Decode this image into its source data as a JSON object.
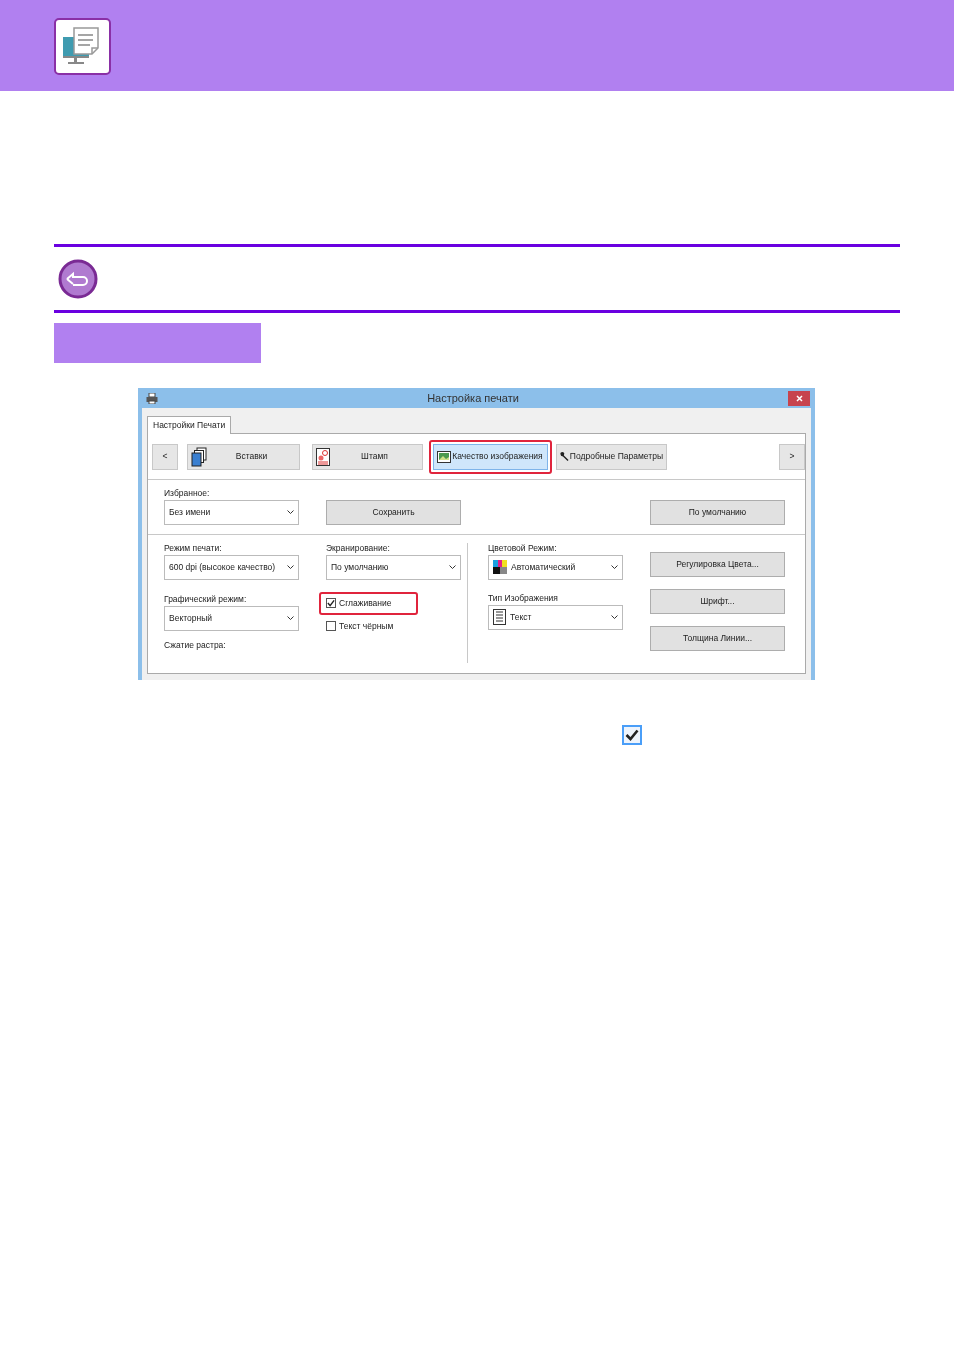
{
  "dialog": {
    "title": "Настройка печати",
    "tabs": [
      {
        "label": "Настройки Печати",
        "selected": true
      }
    ],
    "toolbar": {
      "prev": "<",
      "next": ">",
      "items": [
        {
          "label": "Вставки",
          "selected": false,
          "highlighted": false
        },
        {
          "label": "Штамп",
          "selected": false,
          "highlighted": false
        },
        {
          "label": "Качество изображения",
          "selected": true,
          "highlighted": true
        },
        {
          "label": "Подробные Параметры",
          "selected": false,
          "highlighted": false
        }
      ]
    },
    "favorites": {
      "label": "Избранное:",
      "value": "Без имени"
    },
    "save_button": "Сохранить",
    "default_button": "По умолчанию",
    "print_mode": {
      "label": "Режим печати:",
      "value": "600 dpi (высокое качество)"
    },
    "graphics_mode": {
      "label": "Графический режим:",
      "value": "Векторный"
    },
    "raster_compression": {
      "label": "Сжатие растра:"
    },
    "screening": {
      "label": "Экранирование:",
      "value": "По умолчанию"
    },
    "checkboxes": [
      {
        "label": "Сглаживание",
        "checked": true,
        "highlighted": true
      },
      {
        "label": "Текст чёрным",
        "checked": false,
        "highlighted": false
      }
    ],
    "color_mode": {
      "label": "Цветовой Режим:",
      "value": "Автоматический"
    },
    "image_type": {
      "label": "Тип Изображения",
      "value": "Текст"
    },
    "buttons": [
      "Регулировка Цвета...",
      "Шрифт...",
      "Толщина Линии..."
    ]
  },
  "legend_checkbox": {
    "checked": true
  }
}
